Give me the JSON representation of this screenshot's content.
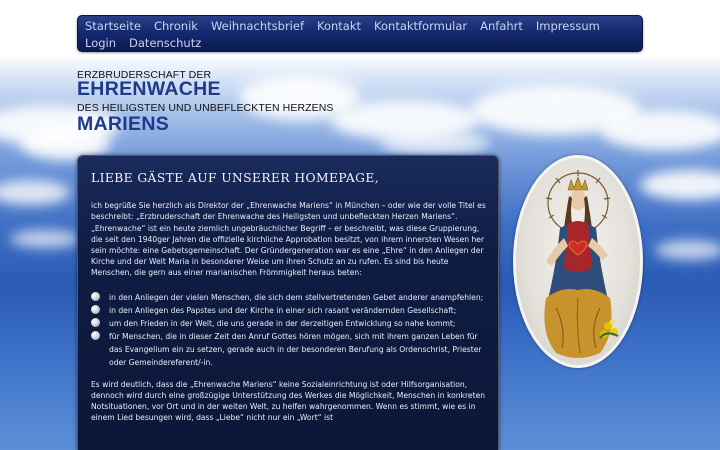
{
  "nav": {
    "items": [
      "Startseite",
      "Chronik",
      "Weihnachtsbrief",
      "Kontakt",
      "Kontaktformular",
      "Anfahrt",
      "Impressum",
      "Login",
      "Datenschutz"
    ]
  },
  "header": {
    "line1": "ERZBRUDERSCHAFT DER",
    "line2": "EHRENWACHE",
    "line3": "DES HEILIGSTEN UND UNBEFLECKTEN HERZENS",
    "line4": "MARIENS"
  },
  "main": {
    "heading": "LIEBE GÄSTE AUF UNSERER HOMEPAGE,",
    "intro": "ich begrüße Sie herzlich als Direktor der „Ehrenwache Mariens“ in München – oder wie der volle Titel es beschreibt: „Erzbruderschaft der Ehrenwache des Heiligsten und unbefleckten Herzen Mariens“.",
    "para1": "„Ehrenwache“ ist ein heute ziemlich ungebräuchlicher Begriff – er beschreibt, was diese Gruppierung, die seit den 1940ger Jahren die offizielle kirchliche Approbation besitzt, von ihrem innersten Wesen her sein möchte: eine Gebetsgemeinschaft. Der Gründergeneration war es eine „Ehre“ in den Anliegen der Kirche und der  Welt Maria in besonderer Weise um ihren Schutz an zu rufen.  Es sind bis heute Menschen, die gern aus einer marianischen Frömmigkeit heraus beten:",
    "bullets": [
      "in den Anliegen der vielen Menschen, die sich dem stellvertretenden Gebet anderer anempfehlen;",
      "in den Anliegen des Papstes und der Kirche in einer sich rasant verändernden Gesellschaft;",
      "um den Frieden in der Welt, die uns gerade in der derzeitigen Entwicklung so nahe kommt;",
      "für Menschen, die in dieser Zeit den Anruf Gottes hören mögen, sich mit ihrem ganzen Leben für das Evangelium ein zu setzen, gerade auch in der besonderen Berufung als Ordenschrist, Priester oder Gemeindereferent/-in."
    ],
    "para2": "Es wird deutlich, dass die „Ehrenwache Mariens“ keine Sozialeinrichtung ist oder Hilfsorganisation, dennoch wird durch eine großzügige Unterstützung des Werkes die Möglichkeit, Menschen in konkreten Notsituationen, vor Ort und in der weiten Welt, zu helfen wahrgenommen. Wenn es stimmt, wie es in einem Lied besungen wird, dass „Liebe“ nicht nur ein „Wort“ ist"
  },
  "colors": {
    "nav_bg": "#152a70",
    "nav_text": "#c9d4f2",
    "title_blue": "#1f3a8a",
    "panel_bg": "#0f1d44"
  }
}
